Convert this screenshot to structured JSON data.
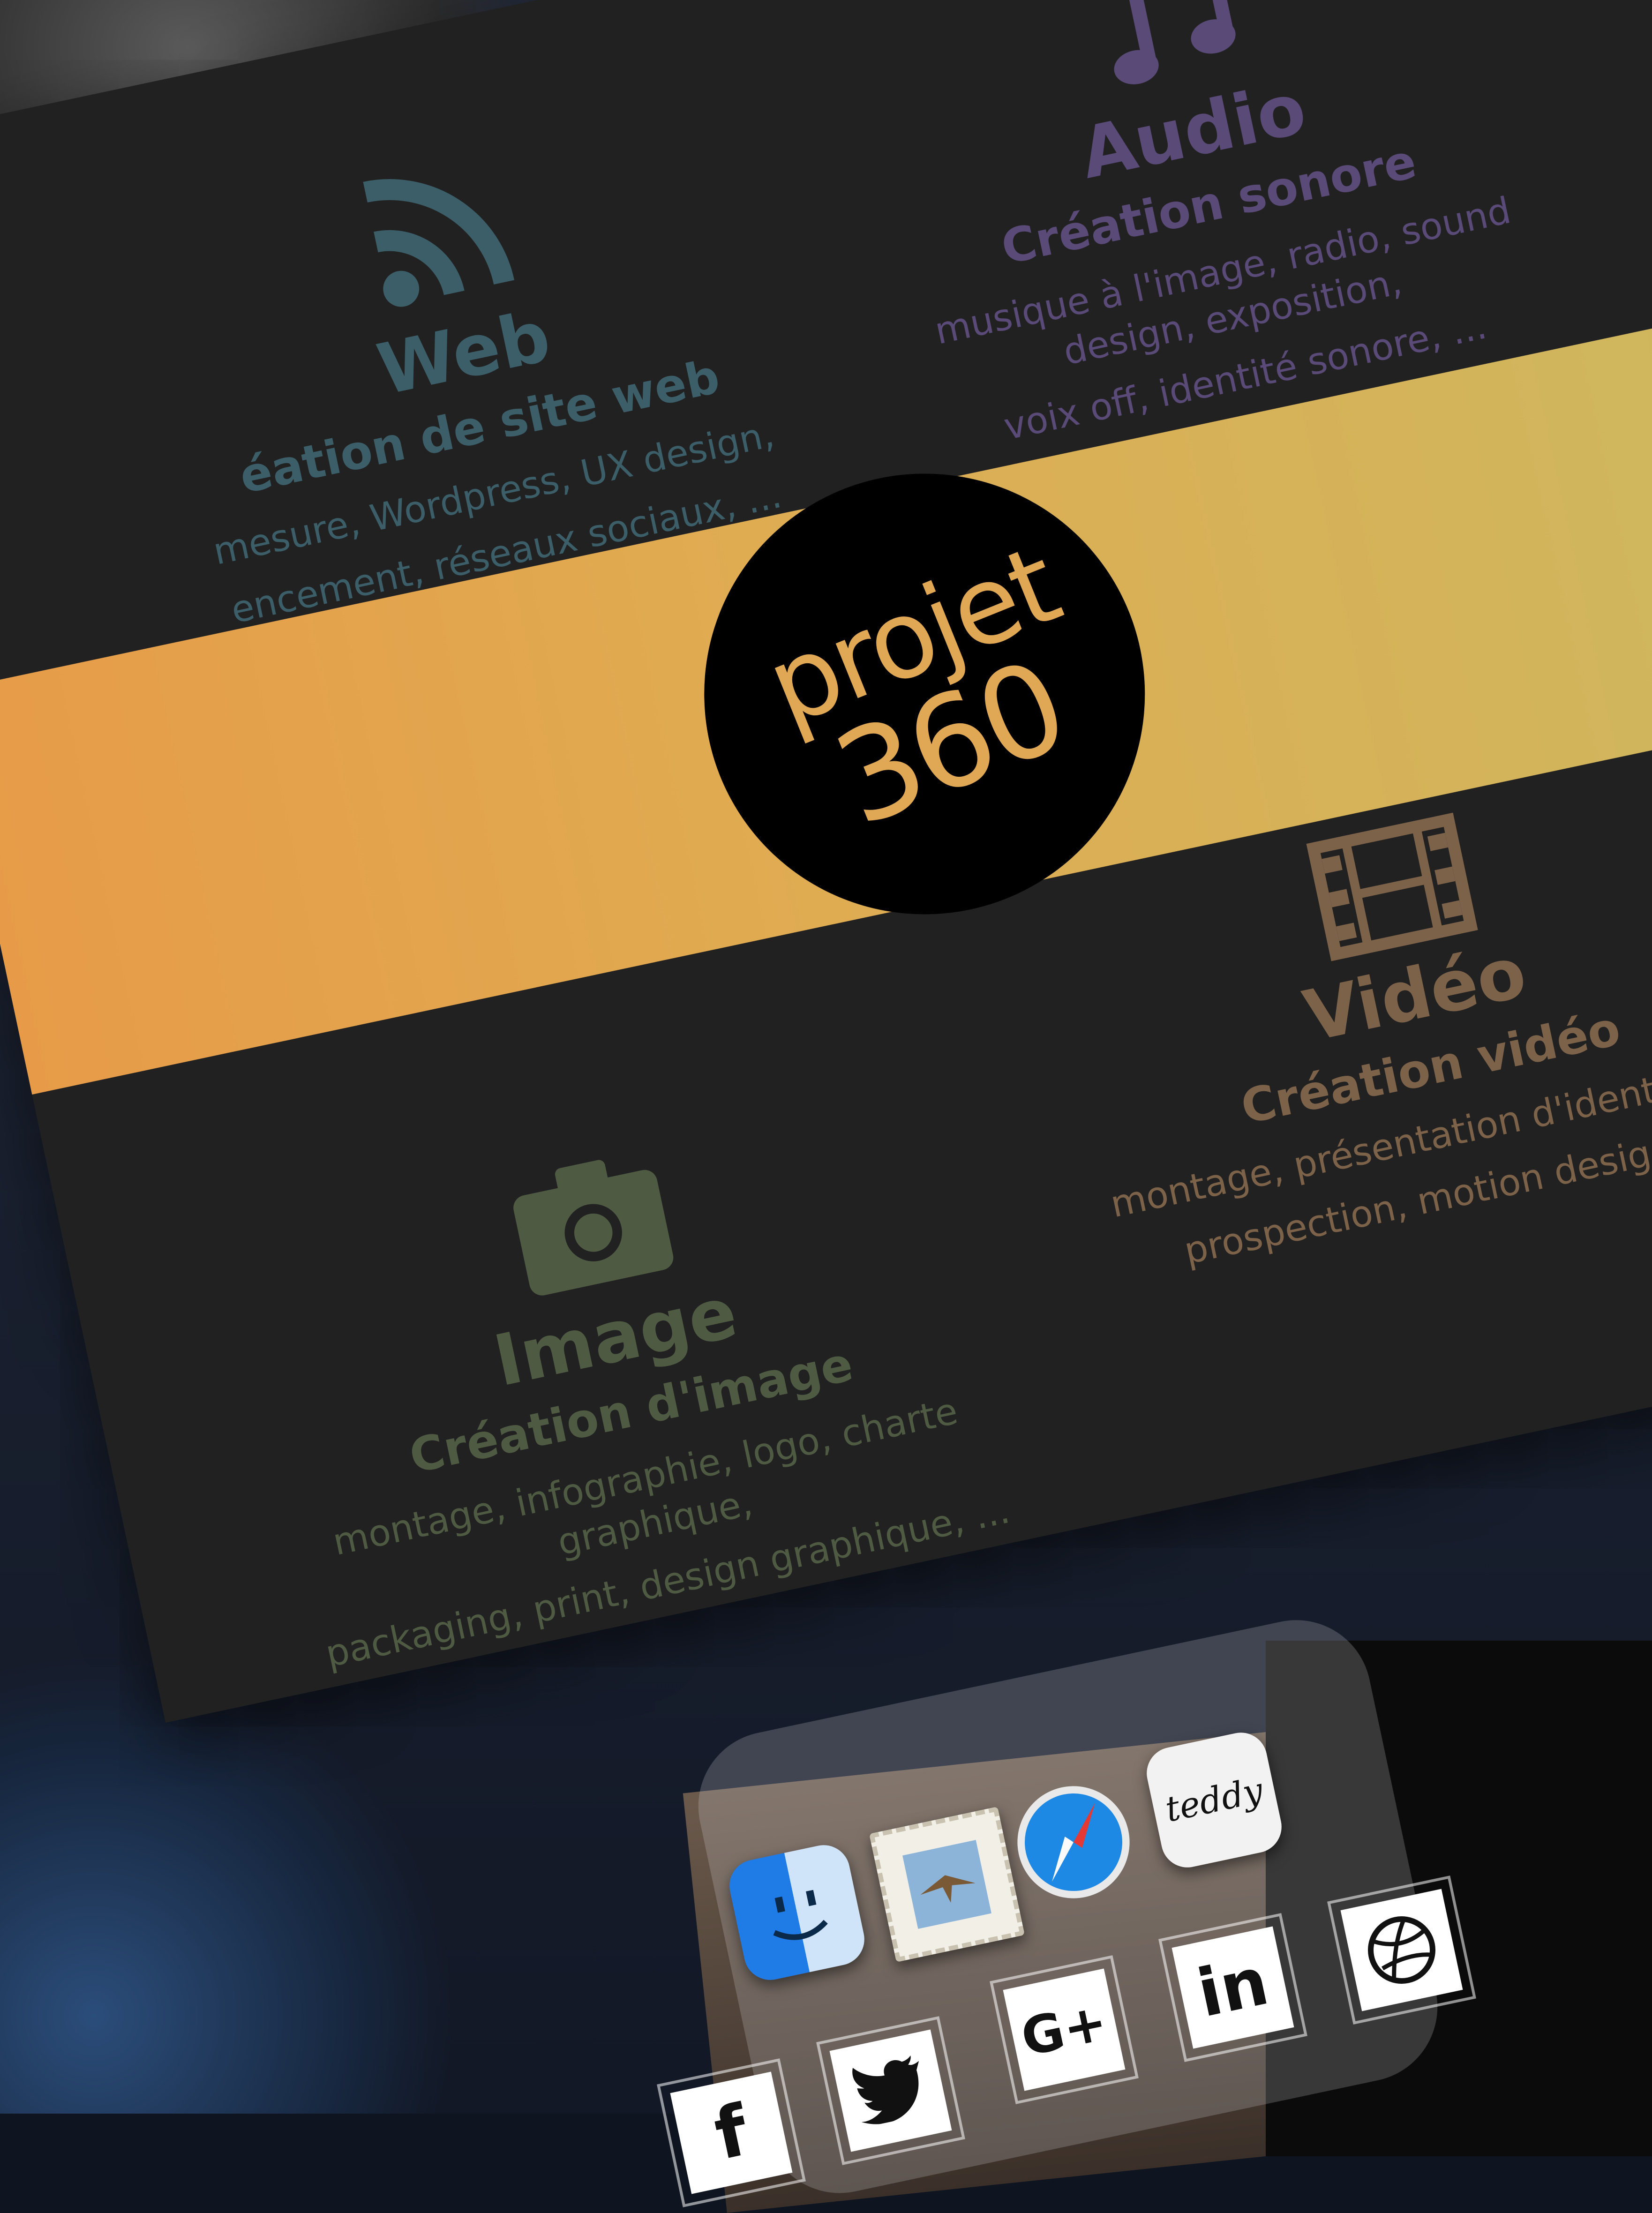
{
  "services": {
    "web": {
      "icon": "rss-feed-icon",
      "title": "Web",
      "subtitle": "éation de site web",
      "desc_line1": "mesure, Wordpress, UX design,",
      "desc_line2": "encement, réseaux sociaux, ..."
    },
    "audio": {
      "icon": "music-note-icon",
      "title": "Audio",
      "subtitle": "Création sonore",
      "desc_line1": "musique à l'image, radio, sound design, exposition,",
      "desc_line2": "voix off, identité sonore, ..."
    },
    "image": {
      "icon": "camera-icon",
      "title": "Image",
      "subtitle": "Création d'image",
      "desc_line1": "montage, infographie, logo, charte graphique,",
      "desc_line2": "packaging, print, design graphique, ..."
    },
    "video": {
      "icon": "film-strip-icon",
      "title": "Vidéo",
      "subtitle": "Création vidéo",
      "desc_line1": "montage, présentation d'identité, vid",
      "desc_line2": "prospection, motion design, ..."
    }
  },
  "logo": {
    "line1": "projet",
    "line2": "360"
  },
  "dock": {
    "apps": [
      {
        "name": "finder-icon"
      },
      {
        "name": "mail-icon"
      },
      {
        "name": "safari-icon"
      },
      {
        "name": "teddy-icon",
        "label": "teddy"
      }
    ],
    "social": [
      {
        "name": "facebook-icon",
        "label": "f"
      },
      {
        "name": "twitter-icon"
      },
      {
        "name": "google-plus-icon",
        "label": "G+"
      },
      {
        "name": "linkedin-icon",
        "label": "in"
      },
      {
        "name": "dribbble-icon"
      }
    ]
  },
  "colors": {
    "card_bg": "#212121",
    "band_start": "#e79b48",
    "band_end": "#ceb75e",
    "logo_text": "#e0a855",
    "web": "#3b5e68",
    "audio": "#5a4a78",
    "image": "#4f5a43",
    "video": "#7c6249"
  }
}
